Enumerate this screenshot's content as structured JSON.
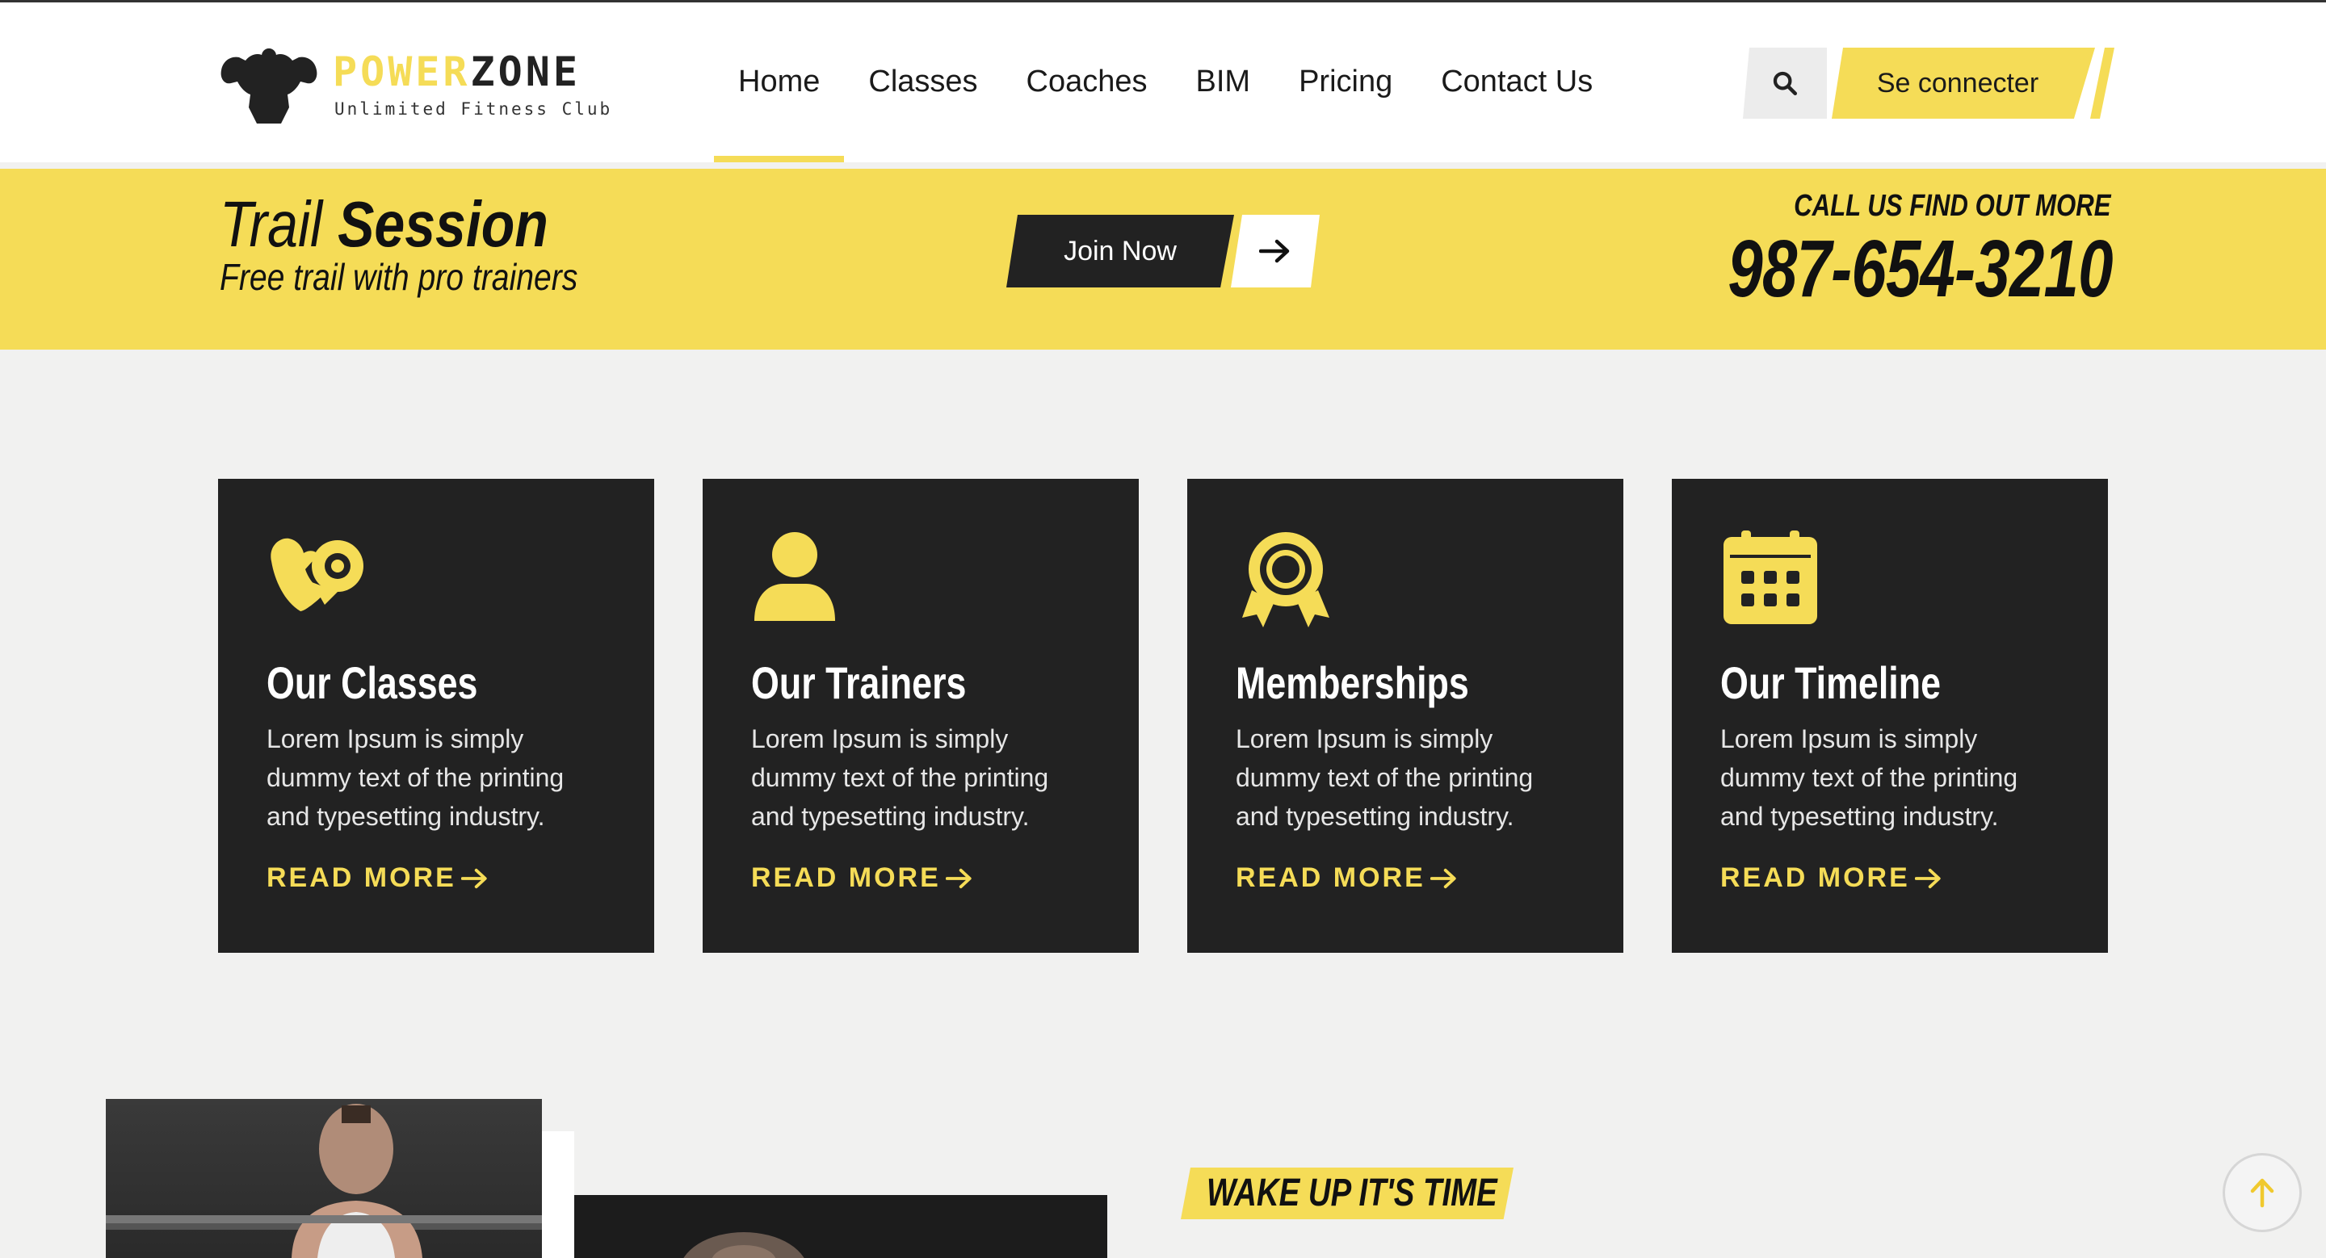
{
  "brand": {
    "name_part1": "POWER",
    "name_part2": "ZONE",
    "tagline": "Unlimited Fitness Club"
  },
  "nav": {
    "items": [
      {
        "label": "Home",
        "active": true
      },
      {
        "label": "Classes",
        "active": false
      },
      {
        "label": "Coaches",
        "active": false
      },
      {
        "label": "BIM",
        "active": false
      },
      {
        "label": "Pricing",
        "active": false
      },
      {
        "label": "Contact Us",
        "active": false
      }
    ],
    "search_icon": "search-icon",
    "connect_label": "Se connecter"
  },
  "trial": {
    "title_light": "Trail",
    "title_bold": "Session",
    "subtitle": "Free trail with pro trainers",
    "join_label": "Join Now",
    "arrow_icon": "arrow-right-icon",
    "call_label": "CALL US FIND OUT MORE",
    "phone": "987-654-3210"
  },
  "cards": [
    {
      "icon": "heart-tape-icon",
      "title": "Our Classes",
      "desc": "Lorem Ipsum is simply dummy text of the printing and typesetting industry.",
      "more": "READ MORE"
    },
    {
      "icon": "user-icon",
      "title": "Our Trainers",
      "desc": "Lorem Ipsum is simply dummy text of the printing and typesetting industry.",
      "more": "READ MORE"
    },
    {
      "icon": "award-icon",
      "title": "Memberships",
      "desc": "Lorem Ipsum is simply dummy text of the printing and typesetting industry.",
      "more": "READ MORE"
    },
    {
      "icon": "calendar-icon",
      "title": "Our Timeline",
      "desc": "Lorem Ipsum is simply dummy text of the printing and typesetting industry.",
      "more": "READ MORE"
    }
  ],
  "section": {
    "wake_label": "WAKE UP IT'S TIME"
  },
  "colors": {
    "accent": "#f5dc57",
    "dark": "#222222",
    "background": "#f1f1f0"
  }
}
